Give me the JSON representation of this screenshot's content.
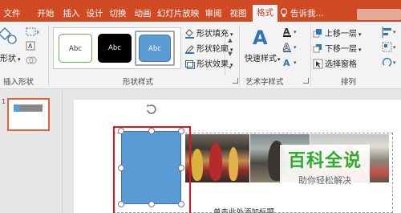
{
  "tabs": [
    {
      "label": "文件"
    },
    {
      "label": "开始"
    },
    {
      "label": "插入"
    },
    {
      "label": "设计"
    },
    {
      "label": "切换"
    },
    {
      "label": "动画"
    },
    {
      "label": "幻灯片放映"
    },
    {
      "label": "审阅"
    },
    {
      "label": "视图"
    },
    {
      "label": "格式",
      "active": true
    }
  ],
  "tell_me": "告诉我...",
  "insert_shapes": {
    "shape_label": "形状",
    "group_label": "插入形状"
  },
  "shape_styles": {
    "swatches": [
      {
        "label": "Abc"
      },
      {
        "label": "Abc"
      },
      {
        "label": "Abc"
      }
    ],
    "fill": "形状填充",
    "outline": "形状轮廓",
    "effects": "形状效果",
    "group_label": "形状样式"
  },
  "wordart": {
    "quick_styles": "快速样式",
    "group_label": "艺术字样式"
  },
  "arrange": {
    "bring_forward": "上移一层",
    "send_backward": "下移一层",
    "selection_pane": "选择窗格",
    "group_label": "排列"
  },
  "slide_pane": {
    "number": "1"
  },
  "slide": {
    "caption": "单击此处添加标题"
  },
  "watermark": {
    "title": "百科全说",
    "subtitle": "助你轻松解决"
  },
  "colors": {
    "accent": "#d04a24",
    "shape_fill": "#5b9bd5",
    "selection": "#e2141c",
    "watermark_green": "#2eac2b"
  }
}
